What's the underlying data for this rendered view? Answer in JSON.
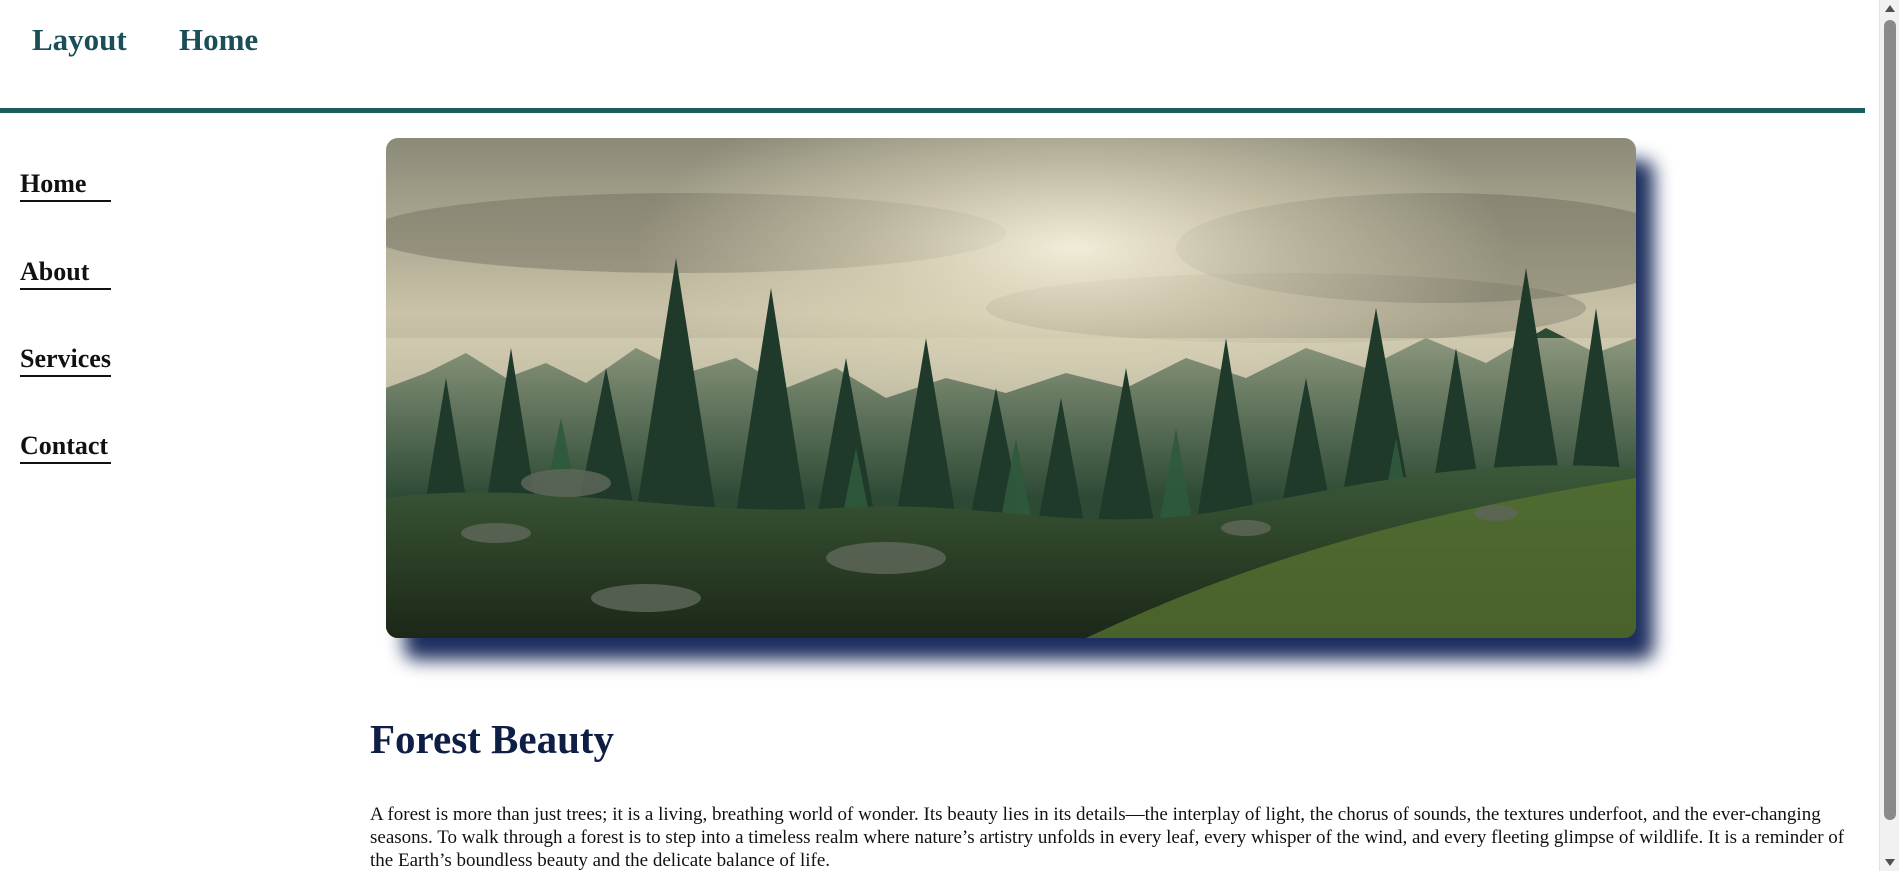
{
  "header": {
    "brand": "Layout",
    "nav_home": "Home"
  },
  "sidebar": {
    "items": [
      {
        "label": "Home"
      },
      {
        "label": "About"
      },
      {
        "label": "Services"
      },
      {
        "label": "Contact"
      }
    ]
  },
  "hero": {
    "image_subject": "misty pine forest under a cloudy sky"
  },
  "article": {
    "title": "Forest Beauty",
    "body": "A forest is more than just trees; it is a living, breathing world of wonder. Its beauty lies in its details—the interplay of light, the chorus of sounds, the textures underfoot, and the ever-changing seasons. To walk through a forest is to step into a timeless realm where nature’s artistry unfolds in every leaf, every whisper of the wind, and every fleeting glimpse of wildlife. It is a reminder of the Earth’s boundless beauty and the delicate balance of life."
  },
  "colors": {
    "accent_teal": "#1c5e5e",
    "title_navy": "#0f1e45",
    "shadow_navy": "#122456"
  }
}
